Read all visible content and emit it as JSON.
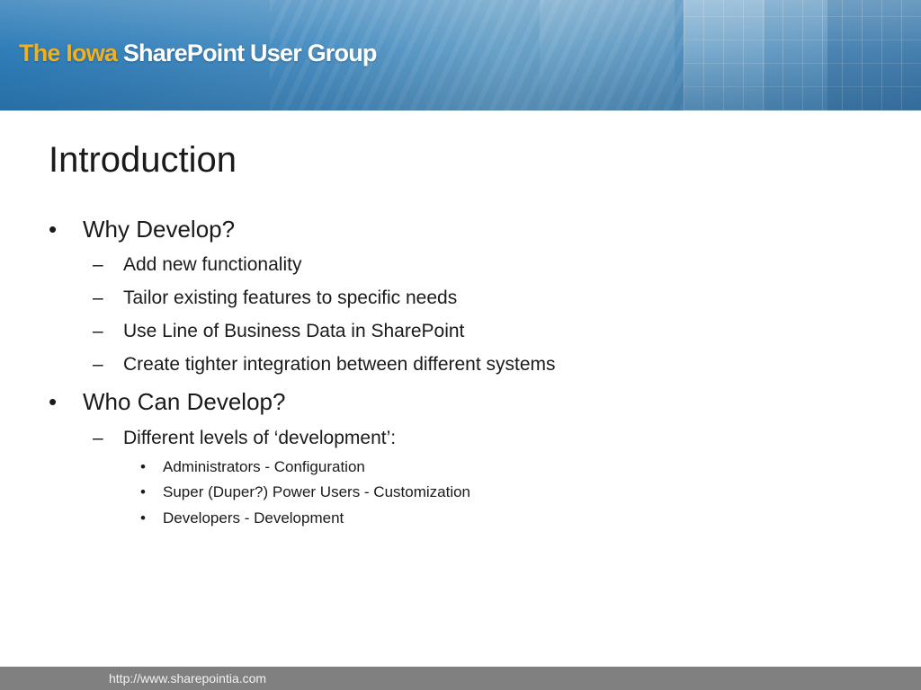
{
  "header": {
    "brand_part1": "The Iowa",
    "brand_part2": "SharePoint User Group"
  },
  "slide": {
    "title": "Introduction",
    "bullets": [
      {
        "text": "Why Develop?",
        "children": [
          {
            "text": "Add new functionality"
          },
          {
            "text": "Tailor existing features to specific needs"
          },
          {
            "text": "Use Line of Business Data in SharePoint"
          },
          {
            "text": "Create tighter integration between different systems"
          }
        ]
      },
      {
        "text": "Who Can Develop?",
        "children": [
          {
            "text": "Different levels of ‘development’:",
            "children": [
              {
                "text": "Administrators - Configuration"
              },
              {
                "text": "Super (Duper?) Power Users - Customization"
              },
              {
                "text": "Developers - Development"
              }
            ]
          }
        ]
      }
    ]
  },
  "footer": {
    "url": "http://www.sharepointia.com"
  },
  "colors": {
    "banner_blue": "#3a7db0",
    "brand_gold": "#f0b020",
    "footer_gray": "#808080"
  }
}
